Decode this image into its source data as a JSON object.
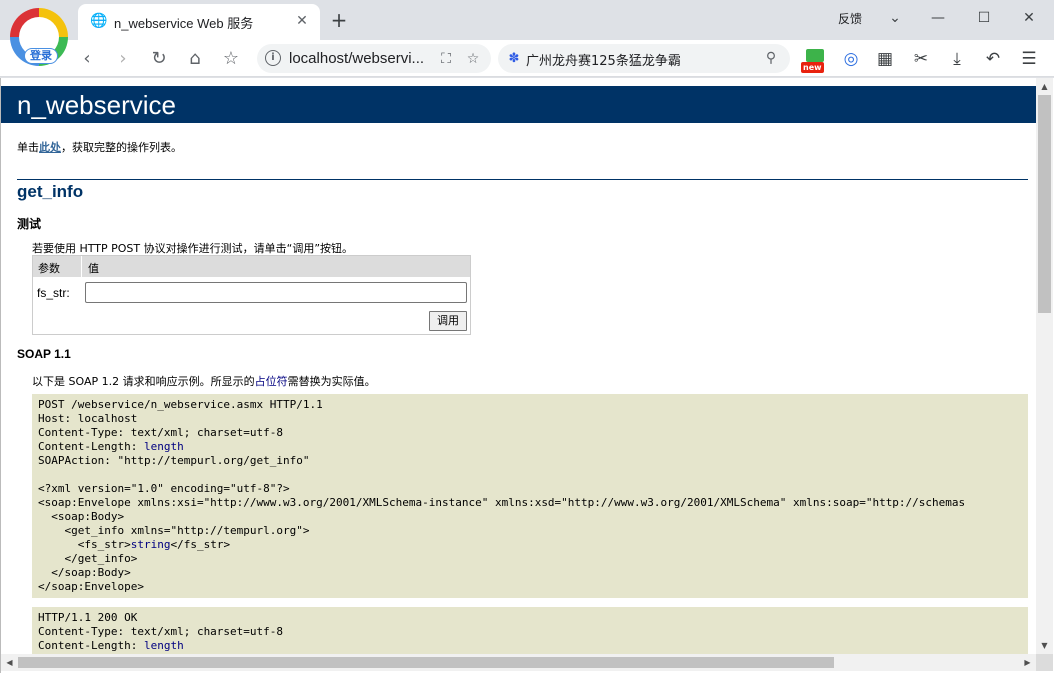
{
  "browser": {
    "login_label": "登录",
    "tab_title": "n_webservice Web 服务",
    "tab_close": "✕",
    "new_tab": "+",
    "feedback": "反馈",
    "win_dropdown": "⌄",
    "win_minimize": "—",
    "win_maximize": "☐",
    "win_close": "✕",
    "url": "localhost/webservi...",
    "search_query": "广州龙舟赛125条猛龙争霸",
    "new_badge": "new"
  },
  "page": {
    "title": "n_webservice",
    "intro_prefix": "单击",
    "intro_link": "此处",
    "intro_suffix": "，获取完整的操作列表。",
    "operation_name": "get_info",
    "test_heading": "测试",
    "test_desc": "若要使用 HTTP POST 协议对操作进行测试，请单击“调用”按钮。",
    "param_col": "参数",
    "value_col": "值",
    "param_label": "fs_str:",
    "param_value": "",
    "invoke_label": "调用",
    "soap_heading": "SOAP 1.1",
    "soap_desc_prefix": "以下是 SOAP 1.2 请求和响应示例。所显示的",
    "soap_desc_placeholder": "占位符",
    "soap_desc_suffix": "需替换为实际值。",
    "request": {
      "line1": "POST /webservice/n_webservice.asmx HTTP/1.1",
      "line2": "Host: localhost",
      "line3": "Content-Type: text/xml; charset=utf-8",
      "line4_prefix": "Content-Length: ",
      "line4_value": "length",
      "line5": "SOAPAction: \"http://tempurl.org/get_info\"",
      "line7": "<?xml version=\"1.0\" encoding=\"utf-8\"?>",
      "line8": "<soap:Envelope xmlns:xsi=\"http://www.w3.org/2001/XMLSchema-instance\" xmlns:xsd=\"http://www.w3.org/2001/XMLSchema\" xmlns:soap=\"http://schemas",
      "line9": "  <soap:Body>",
      "line10": "    <get_info xmlns=\"http://tempurl.org\">",
      "line11_prefix": "      <fs_str>",
      "line11_value": "string",
      "line11_suffix": "</fs_str>",
      "line12": "    </get_info>",
      "line13": "  </soap:Body>",
      "line14": "</soap:Envelope>"
    },
    "response": {
      "line1": "HTTP/1.1 200 OK",
      "line2": "Content-Type: text/xml; charset=utf-8",
      "line3_prefix": "Content-Length: ",
      "line3_value": "length"
    }
  },
  "colors": {
    "header_bg": "#003366",
    "code_bg": "#e5e5cc",
    "link": "#336699",
    "placeholder": "#000080"
  }
}
